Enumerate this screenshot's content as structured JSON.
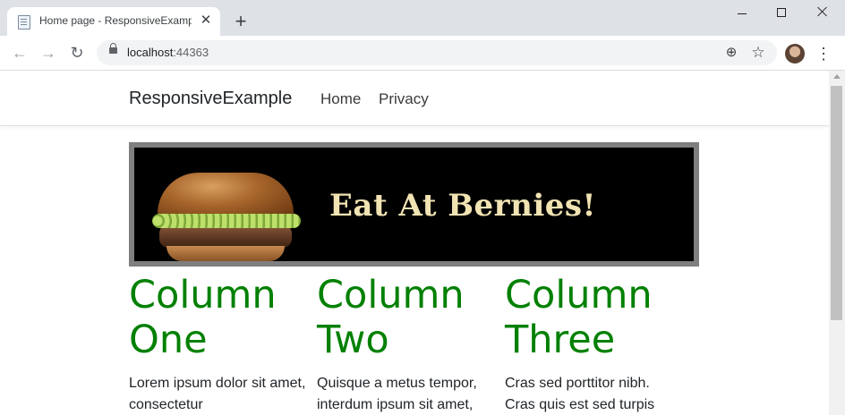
{
  "browser": {
    "tab_title": "Home page - ResponsiveExample",
    "tab_close": "✕",
    "new_tab": "+",
    "url_host": "localhost",
    "url_port": ":44363"
  },
  "site": {
    "brand": "ResponsiveExample",
    "nav": [
      "Home",
      "Privacy"
    ],
    "banner_text": "Eat At Bernies!",
    "columns": [
      {
        "heading": "Column One",
        "text": "Lorem ipsum dolor sit amet, consectetur"
      },
      {
        "heading": "Column Two",
        "text": "Quisque a metus tempor, interdum ipsum sit amet,"
      },
      {
        "heading": "Column Three",
        "text": "Cras sed porttitor nibh. Cras quis est sed turpis"
      }
    ]
  },
  "colors": {
    "heading": "#008000",
    "banner_text": "#f1e3b2",
    "banner_border": "#7f7f7f"
  }
}
